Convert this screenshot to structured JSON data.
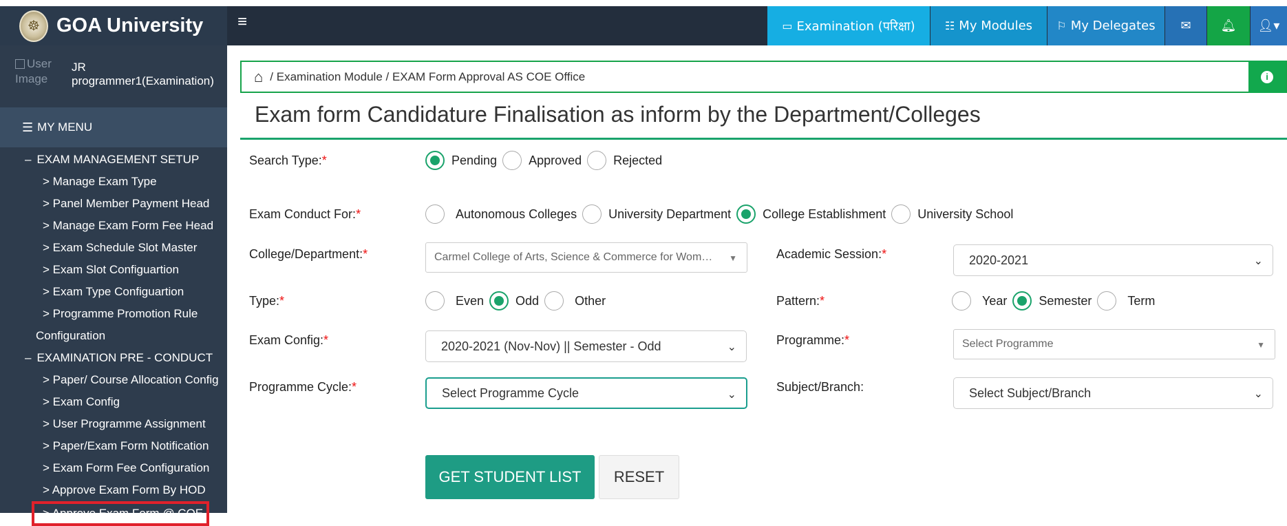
{
  "header": {
    "brand": "GOA University",
    "hamburger_icon": "menu-icon",
    "nav": {
      "examination": "Examination (परिक्षा)",
      "modules": "My Modules",
      "delegates": "My Delegates"
    }
  },
  "sidebar": {
    "user_img_alt": "User Image",
    "user_line1": "JR",
    "user_line2": "programmer1(Examination)",
    "menu_title": "MY MENU",
    "items": [
      {
        "label": "EXAM MANAGEMENT SETUP"
      },
      {
        "label": "> Manage Exam Type"
      },
      {
        "label": "> Panel Member Payment Head"
      },
      {
        "label": "> Manage Exam Form Fee Head"
      },
      {
        "label": "> Exam Schedule Slot Master"
      },
      {
        "label": "> Exam Slot Configuartion"
      },
      {
        "label": "> Exam Type Configuartion"
      },
      {
        "label": "> Programme Promotion Rule"
      },
      {
        "label": "Configuration"
      },
      {
        "label": "EXAMINATION PRE - CONDUCT"
      },
      {
        "label": "> Paper/ Course Allocation Config"
      },
      {
        "label": "> Exam Config"
      },
      {
        "label": "> User Programme Assignment"
      },
      {
        "label": "> Paper/Exam Form Notification"
      },
      {
        "label": "> Exam Form Fee Configuration"
      },
      {
        "label": "> Approve Exam Form By HOD"
      },
      {
        "label": "> Approve Exam Form @ COE"
      }
    ]
  },
  "breadcrumb": {
    "path": "/ Examination Module / EXAM Form Approval AS COE Office"
  },
  "page_title": "Exam form Candidature Finalisation as inform by the Department/Colleges",
  "form": {
    "search_type": {
      "label": "Search Type:",
      "options": [
        "Pending",
        "Approved",
        "Rejected"
      ],
      "selected": "Pending"
    },
    "exam_conduct": {
      "label": "Exam Conduct For:",
      "options": [
        "Autonomous Colleges",
        "University Department",
        "College Establishment",
        "University School"
      ],
      "selected": "College Establishment"
    },
    "college": {
      "label": "College/Department:",
      "value": "Carmel College of Arts, Science & Commerce for Wom…"
    },
    "academic_session": {
      "label": "Academic Session:",
      "value": "2020-2021"
    },
    "type": {
      "label": "Type:",
      "options": [
        "Even",
        "Odd",
        "Other"
      ],
      "selected": "Odd"
    },
    "pattern": {
      "label": "Pattern:",
      "options": [
        "Year",
        "Semester",
        "Term"
      ],
      "selected": "Semester"
    },
    "exam_config": {
      "label": "Exam Config:",
      "value": "2020-2021 (Nov-Nov) || Semester - Odd"
    },
    "programme": {
      "label": "Programme:",
      "value": "Select Programme"
    },
    "programme_cycle": {
      "label": "Programme Cycle:",
      "value": "Select Programme Cycle"
    },
    "subject_branch": {
      "label": "Subject/Branch:",
      "value": "Select Subject/Branch"
    },
    "req_mark": "*"
  },
  "buttons": {
    "get_list": "GET STUDENT LIST",
    "reset": "RESET"
  },
  "colors": {
    "accent": "#1aa36b",
    "topbar": "#232e3d",
    "sidebar": "#2e3c4d",
    "highlight": "#e0212b"
  }
}
